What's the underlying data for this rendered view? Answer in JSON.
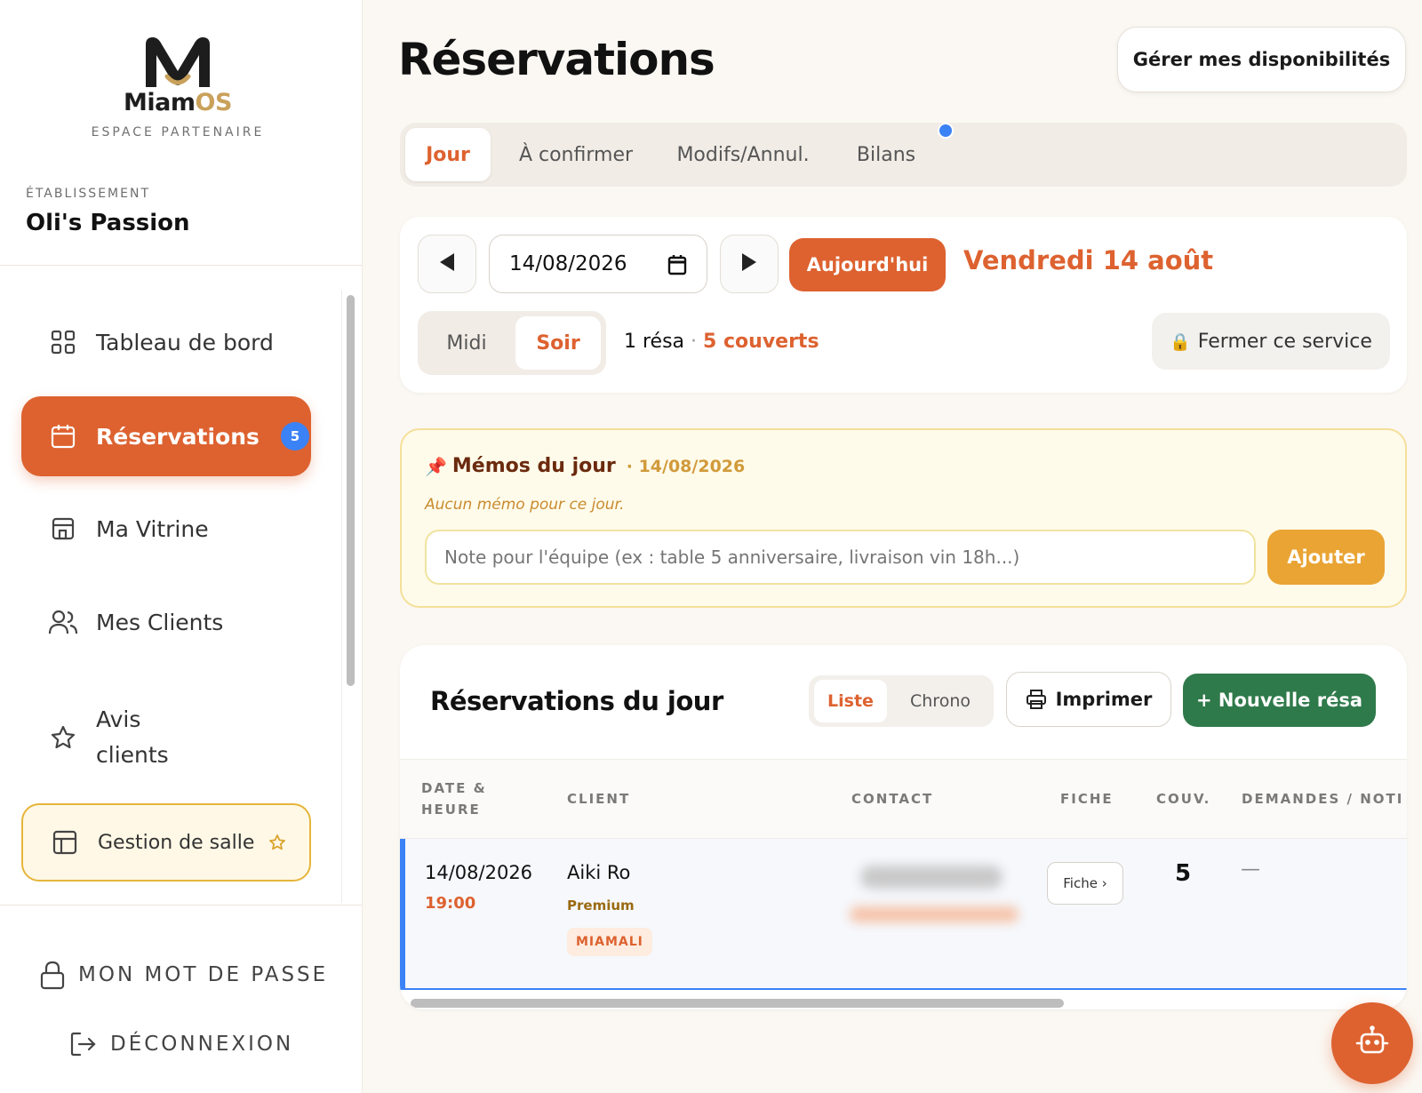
{
  "brand": {
    "name_a": "Miam",
    "name_b": "OS",
    "subtitle": "ESPACE PARTENAIRE",
    "dark_color": "#1d1d1d",
    "gold_color": "#c9a15b"
  },
  "establishment": {
    "label": "ÉTABLISSEMENT",
    "name": "Oli's Passion"
  },
  "sidebar": {
    "items": [
      {
        "label": "Tableau de bord",
        "icon": "grid-icon"
      },
      {
        "label": "Réservations",
        "icon": "calendar-icon",
        "badge": "5",
        "active": true
      },
      {
        "label": "Ma Vitrine",
        "icon": "storefront-icon"
      },
      {
        "label": "Mes Clients",
        "icon": "users-icon"
      },
      {
        "label_line1": "Avis",
        "label_line2": "clients",
        "icon": "star-icon"
      },
      {
        "label": "Gestion de salle",
        "icon": "layout-icon",
        "suffix_icon": "star-icon"
      }
    ],
    "password": "MON MOT DE PASSE",
    "logout": "DÉCONNEXION"
  },
  "header": {
    "title": "Réservations",
    "availability_button": "Gérer mes disponibilités"
  },
  "tabs": [
    "Jour",
    "À confirmer",
    "Modifs/Annul.",
    "Bilans"
  ],
  "day_panel": {
    "date_value": "14/08/2026",
    "today_button": "Aujourd'hui",
    "day_label": "Vendredi 14 août",
    "services": [
      "Midi",
      "Soir"
    ],
    "active_service": "Soir",
    "resa_count": "1 résa",
    "separator": "·",
    "covers": "5 couverts",
    "close_service": "Fermer ce service"
  },
  "memo": {
    "title": "Mémos du jour",
    "date": "· 14/08/2026",
    "empty": "Aucun mémo pour ce jour.",
    "placeholder": "Note pour l'équipe (ex : table 5 anniversaire, livraison vin 18h...)",
    "add_button": "Ajouter"
  },
  "reservations": {
    "title": "Réservations du jour",
    "views": [
      "Liste",
      "Chrono"
    ],
    "print_button": "Imprimer",
    "new_button": "+ Nouvelle résa",
    "columns": {
      "date_line1": "DATE &",
      "date_line2": "HEURE",
      "client": "CLIENT",
      "contact": "CONTACT",
      "fiche": "FICHE",
      "couv": "COUV.",
      "demandes": "DEMANDES / NOTI"
    },
    "rows": [
      {
        "date": "14/08/2026",
        "time": "19:00",
        "client": "Aiki Ro",
        "tier": "Premium",
        "tag": "MIAMALI",
        "fiche": "Fiche ›",
        "couv": "5",
        "demandes": "—"
      }
    ]
  },
  "colors": {
    "accent": "#dd6230",
    "blue": "#3b82f6",
    "green": "#2f7a4a",
    "memo_yellow": "#e9a433"
  }
}
